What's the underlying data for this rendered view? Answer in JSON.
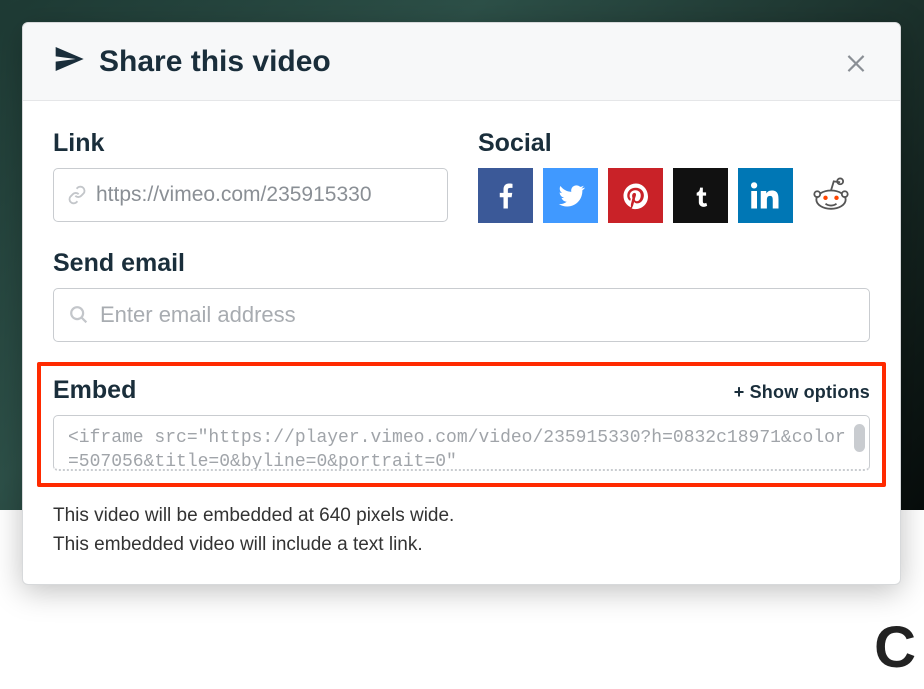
{
  "header": {
    "title": "Share this video"
  },
  "link": {
    "label": "Link",
    "value": "https://vimeo.com/235915330"
  },
  "social": {
    "label": "Social",
    "items": [
      {
        "name": "facebook"
      },
      {
        "name": "twitter"
      },
      {
        "name": "pinterest"
      },
      {
        "name": "tumblr"
      },
      {
        "name": "linkedin"
      },
      {
        "name": "reddit"
      }
    ]
  },
  "email": {
    "label": "Send email",
    "placeholder": "Enter email address"
  },
  "embed": {
    "label": "Embed",
    "show_options": "+ Show options",
    "code": "<iframe src=\"https://player.vimeo.com/video/235915330?h=0832c18971&color=507056&title=0&byline=0&portrait=0\""
  },
  "notes": {
    "line1": "This video will be embedded at 640 pixels wide.",
    "line2": "This embedded video will include a text link."
  }
}
